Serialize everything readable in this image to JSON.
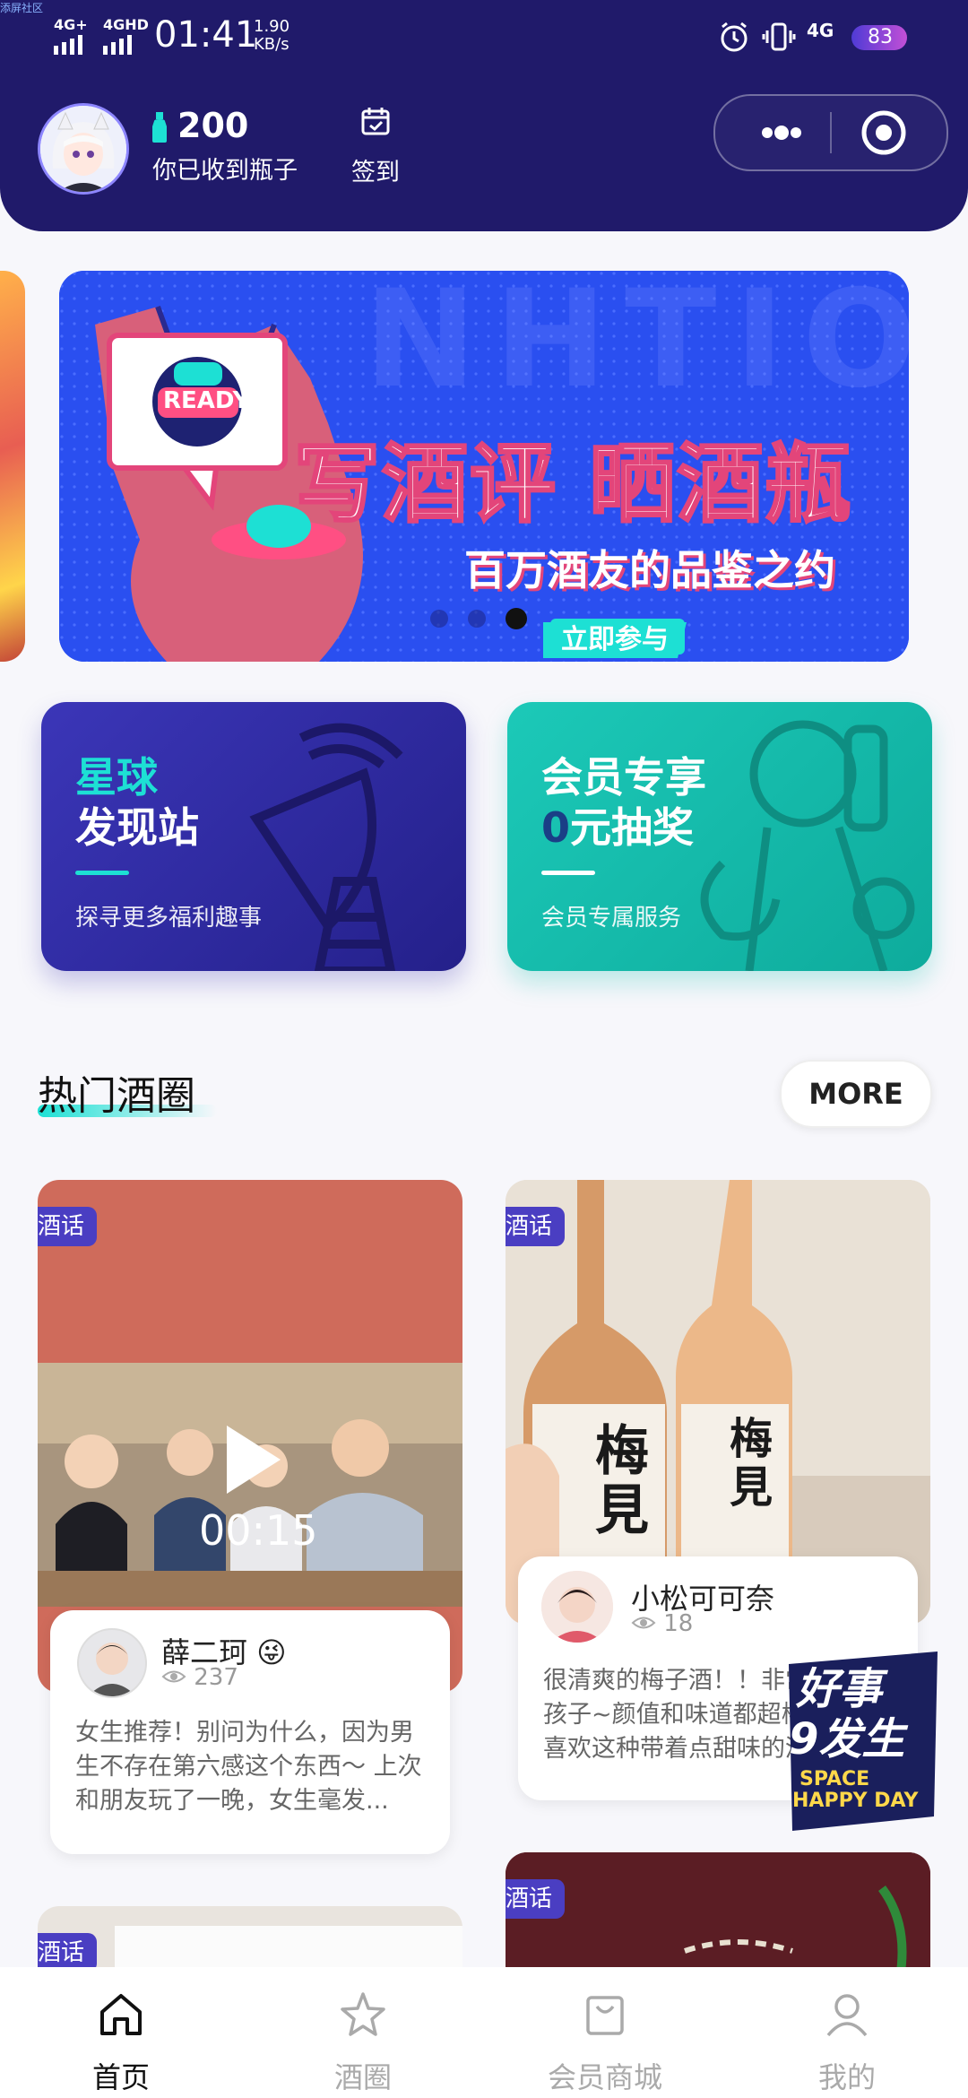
{
  "status_bar": {
    "tiny_label": "添屏社区",
    "network1": "4G+",
    "network2": "4GHD",
    "time": "01:41",
    "speed_value": "1.90",
    "speed_unit": "KB/s",
    "network3": "4G",
    "battery": "83"
  },
  "profile": {
    "bottle_count": "200",
    "bottle_label": "你已收到瓶子",
    "checkin_label": "签到"
  },
  "banner": {
    "title": "写酒评 晒酒瓶",
    "subtitle": "百万酒友的品鉴之约",
    "button": "立即参与",
    "badge": "READY",
    "bg_text": "NHTION",
    "dots": 3,
    "active_dot": 3
  },
  "cards": [
    {
      "line1": "星球",
      "line2": "发现站",
      "sub": "探寻更多福利趣事"
    },
    {
      "line1": "会员专享",
      "line2_num": "0",
      "line2_rest": "元抽奖",
      "sub": "会员专属服务"
    }
  ],
  "section": {
    "title": "热门酒圈",
    "more": "MORE"
  },
  "posts": [
    {
      "tag": "酒话",
      "duration": "00:15",
      "user": "薛二珂",
      "views": "237",
      "desc": "女生推荐！别问为什么，因为男生不存在第六感这个东西～ 上次和朋友玩了一晚，女生毫发..."
    },
    {
      "tag": "酒话",
      "user": "小松可可奈",
      "views": "18",
      "desc": "很清爽的梅子酒！！非常适合女孩子~颜值和味道都超棒！特别喜欢这种带着点甜味的酒",
      "bottle_text": "梅見",
      "sticker_line1": "好事",
      "sticker_line2": "9发生",
      "sticker_line3": "SPACE",
      "sticker_line4": "HAPPY DAY"
    },
    {
      "tag": "酒话"
    },
    {
      "tag": "酒话"
    }
  ],
  "tabbar": {
    "items": [
      {
        "label": "首页",
        "icon": "home-icon",
        "active": true
      },
      {
        "label": "酒圈",
        "icon": "star-icon",
        "active": false
      },
      {
        "label": "会员商城",
        "icon": "bag-icon",
        "active": false
      },
      {
        "label": "我的",
        "icon": "user-icon",
        "active": false
      }
    ]
  },
  "colors": {
    "header_bg": "#201a6a",
    "accent_cyan": "#1de0d4",
    "card1_bg": "#2d2a9c",
    "card2_bg": "#10bfae",
    "tag_bg": "#4a3ec2"
  }
}
